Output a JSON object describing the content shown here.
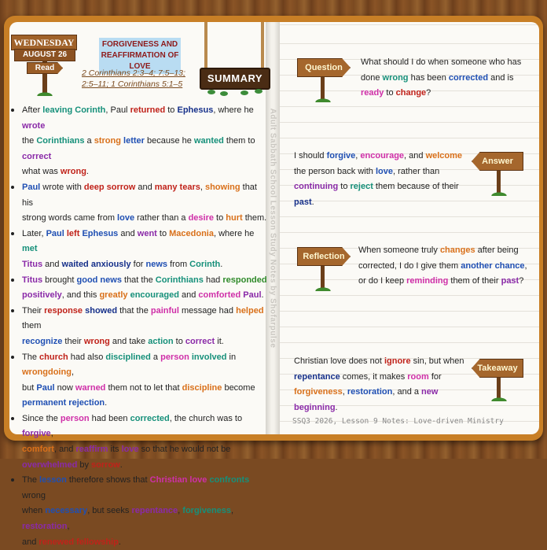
{
  "colors": {
    "red": "#c0221a",
    "blue": "#1f4fb3",
    "teal": "#16907a",
    "green": "#2f8a2a",
    "purple": "#8a2aa8",
    "orange": "#d9701a",
    "magenta": "#cf2fa8",
    "brown": "#9a6a10",
    "navy": "#16308a",
    "black": "#222222"
  },
  "day_sign": {
    "day": "WEDNESDAY",
    "date": "AUGUST 26",
    "read": "Read"
  },
  "lesson_title": {
    "line1": "FORGIVENESS AND",
    "line2": "REAFFIRMATION OF LOVE"
  },
  "references": {
    "line1": "2 Corinthians 2:3–4; 7:5–13;",
    "line2": "2:5–11; 1 Corinthians 5:1–5"
  },
  "summary_label": "SUMMARY",
  "spine_text": "Adult Sabbath School Lesson Study Notes by Shofarpulse",
  "bullets": [
    [
      [
        "After ",
        0
      ],
      [
        " leaving",
        1,
        "teal"
      ],
      [
        " Corinth",
        1,
        "teal"
      ],
      [
        ", Paul ",
        0
      ],
      [
        "returned",
        1,
        "red"
      ],
      [
        " to ",
        0
      ],
      [
        "Ephesus",
        1,
        "navy"
      ],
      [
        ", where he ",
        0
      ],
      [
        "wrote",
        1,
        "purple"
      ]
    ],
    [
      [
        "the ",
        0
      ],
      [
        "Corinthians",
        1,
        "teal"
      ],
      [
        " a ",
        0
      ],
      [
        "strong",
        1,
        "orange"
      ],
      [
        " ",
        0
      ],
      [
        "letter",
        1,
        "blue"
      ],
      [
        " because he ",
        0
      ],
      [
        "wanted",
        1,
        "teal"
      ],
      [
        " them to ",
        0
      ],
      [
        "correct",
        1,
        "purple"
      ]
    ],
    [
      [
        "what was ",
        0
      ],
      [
        "wrong",
        1,
        "red"
      ],
      [
        ".",
        0
      ]
    ],
    [
      [
        "Paul",
        1,
        "blue"
      ],
      [
        " wrote with ",
        0
      ],
      [
        "deep sorrow",
        1,
        "red"
      ],
      [
        " and ",
        0
      ],
      [
        "many tears",
        1,
        "red"
      ],
      [
        ", ",
        0
      ],
      [
        "showing",
        1,
        "orange"
      ],
      [
        " that his",
        0
      ]
    ],
    [
      [
        "strong words came from ",
        0
      ],
      [
        "love",
        1,
        "blue"
      ],
      [
        " rather than a ",
        0
      ],
      [
        "desire",
        1,
        "magenta"
      ],
      [
        " to ",
        0
      ],
      [
        "hurt",
        1,
        "orange"
      ],
      [
        " them.",
        0
      ]
    ],
    [
      [
        "Later, ",
        0
      ],
      [
        "Paul",
        1,
        "blue"
      ],
      [
        " ",
        0
      ],
      [
        "left",
        1,
        "red"
      ],
      [
        " ",
        0
      ],
      [
        "Ephesus",
        1,
        "blue"
      ],
      [
        " and ",
        0
      ],
      [
        "went",
        1,
        "purple"
      ],
      [
        " to ",
        0
      ],
      [
        "Macedonia",
        1,
        "orange"
      ],
      [
        ", where he ",
        0
      ],
      [
        "met",
        1,
        "teal"
      ]
    ],
    [
      [
        "Titus",
        1,
        "purple"
      ],
      [
        " and ",
        0
      ],
      [
        "waited anxiously",
        1,
        "navy"
      ],
      [
        " for ",
        0
      ],
      [
        "news",
        1,
        "blue"
      ],
      [
        " from ",
        0
      ],
      [
        "Corinth",
        1,
        "teal"
      ],
      [
        ".",
        0
      ]
    ],
    [
      [
        "Titus",
        1,
        "purple"
      ],
      [
        " brought ",
        0
      ],
      [
        "good news",
        1,
        "blue"
      ],
      [
        " that the ",
        0
      ],
      [
        "Corinthians",
        1,
        "teal"
      ],
      [
        " had ",
        0
      ],
      [
        "responded",
        1,
        "green"
      ]
    ],
    [
      [
        "positively",
        1,
        "purple"
      ],
      [
        ", and this ",
        0
      ],
      [
        "greatly",
        1,
        "orange"
      ],
      [
        " ",
        0
      ],
      [
        "encouraged",
        1,
        "teal"
      ],
      [
        " and ",
        0
      ],
      [
        "comforted",
        1,
        "magenta"
      ],
      [
        " ",
        0
      ],
      [
        "Paul",
        1,
        "purple"
      ],
      [
        ".",
        0
      ]
    ],
    [
      [
        "Their ",
        0
      ],
      [
        "response",
        1,
        "red"
      ],
      [
        " ",
        0
      ],
      [
        "showed",
        1,
        "navy"
      ],
      [
        " that the ",
        0
      ],
      [
        "painful",
        1,
        "magenta"
      ],
      [
        " message had ",
        0
      ],
      [
        "helped",
        1,
        "orange"
      ],
      [
        " them",
        0
      ]
    ],
    [
      [
        "recognize",
        1,
        "blue"
      ],
      [
        " their ",
        0
      ],
      [
        "wrong",
        1,
        "red"
      ],
      [
        " and take ",
        0
      ],
      [
        "action",
        1,
        "teal"
      ],
      [
        " to ",
        0
      ],
      [
        "correct",
        1,
        "purple"
      ],
      [
        " it.",
        0
      ]
    ],
    [
      [
        "The ",
        0
      ],
      [
        "church",
        1,
        "red"
      ],
      [
        " had also ",
        0
      ],
      [
        "disciplined",
        1,
        "teal"
      ],
      [
        " a ",
        0
      ],
      [
        "person",
        1,
        "magenta"
      ],
      [
        " ",
        0
      ],
      [
        "involved",
        1,
        "teal"
      ],
      [
        " in ",
        0
      ],
      [
        "wrongdoing",
        1,
        "orange"
      ],
      [
        ",",
        0
      ]
    ],
    [
      [
        "but ",
        0
      ],
      [
        "Paul",
        1,
        "blue"
      ],
      [
        " now ",
        0
      ],
      [
        "warned",
        1,
        "magenta"
      ],
      [
        " them not to let that ",
        0
      ],
      [
        "discipline",
        1,
        "orange"
      ],
      [
        " become",
        0
      ]
    ],
    [
      [
        "permanent rejection",
        1,
        "blue"
      ],
      [
        ".",
        0
      ]
    ],
    [
      [
        "Since the ",
        0
      ],
      [
        "person",
        1,
        "magenta"
      ],
      [
        " had been ",
        0
      ],
      [
        "corrected",
        1,
        "teal"
      ],
      [
        ", the church was to ",
        0
      ],
      [
        "forgive",
        1,
        "purple"
      ],
      [
        ",",
        0
      ]
    ],
    [
      [
        "comfort",
        1,
        "orange"
      ],
      [
        ", and ",
        0
      ],
      [
        "reaffirm",
        1,
        "purple"
      ],
      [
        " its ",
        0
      ],
      [
        "love",
        1,
        "purple"
      ],
      [
        " so that he would not be",
        0
      ]
    ],
    [
      [
        "overwhelmed",
        1,
        "purple"
      ],
      [
        " by ",
        0
      ],
      [
        "sorrow",
        1,
        "red"
      ],
      [
        ".",
        0
      ]
    ],
    [
      [
        "The ",
        0
      ],
      [
        "lesson",
        1,
        "blue"
      ],
      [
        " therefore shows that ",
        0
      ],
      [
        "Christian love",
        1,
        "magenta"
      ],
      [
        " ",
        0
      ],
      [
        "confronts",
        1,
        "teal"
      ],
      [
        " wrong",
        0
      ]
    ],
    [
      [
        "when ",
        0
      ],
      [
        "necessary",
        1,
        "blue"
      ],
      [
        ", but seeks ",
        0
      ],
      [
        "repentance",
        1,
        "purple"
      ],
      [
        ", ",
        0
      ],
      [
        "forgiveness",
        1,
        "teal"
      ],
      [
        ", ",
        0
      ],
      [
        "restoration",
        1,
        "purple"
      ],
      [
        ",",
        0
      ]
    ],
    [
      [
        "and ",
        0
      ],
      [
        "renewed fellowship",
        1,
        "red"
      ],
      [
        ".",
        0
      ]
    ]
  ],
  "bullet_starts": [
    0,
    3,
    5,
    7,
    9,
    11,
    14,
    17
  ],
  "question": {
    "label": "Question",
    "lines": [
      [
        [
          "What should I do when someone who has",
          0
        ]
      ],
      [
        [
          "done ",
          0
        ],
        [
          "wrong",
          1,
          "teal"
        ],
        [
          " has been ",
          0
        ],
        [
          "corrected",
          1,
          "blue"
        ],
        [
          " and is",
          0
        ]
      ],
      [
        [
          "ready",
          1,
          "magenta"
        ],
        [
          " to ",
          0
        ],
        [
          "change",
          1,
          "red"
        ],
        [
          "?",
          0
        ]
      ]
    ]
  },
  "answer": {
    "label": "Answer",
    "lines": [
      [
        [
          "I should ",
          0
        ],
        [
          "forgive",
          1,
          "blue"
        ],
        [
          ", ",
          0
        ],
        [
          "encourage",
          1,
          "magenta"
        ],
        [
          ", and ",
          0
        ],
        [
          "welcome",
          1,
          "orange"
        ]
      ],
      [
        [
          "the person back with ",
          0
        ],
        [
          "love",
          1,
          "blue"
        ],
        [
          ", rather than",
          0
        ]
      ],
      [
        [
          "continuing",
          1,
          "purple"
        ],
        [
          " to ",
          0
        ],
        [
          "reject",
          1,
          "teal"
        ],
        [
          " them because of their",
          0
        ]
      ],
      [
        [
          "past",
          1,
          "navy"
        ],
        [
          ".",
          0
        ]
      ]
    ]
  },
  "reflection": {
    "label": "Reflection",
    "lines": [
      [
        [
          "When someone truly ",
          0
        ],
        [
          "changes",
          1,
          "orange"
        ],
        [
          " after being",
          0
        ]
      ],
      [
        [
          "corrected, I do I give them ",
          0
        ],
        [
          "another chance",
          1,
          "blue"
        ],
        [
          ",",
          0
        ]
      ],
      [
        [
          "or do I keep ",
          0
        ],
        [
          "reminding",
          1,
          "magenta"
        ],
        [
          " them of their ",
          0
        ],
        [
          "past",
          1,
          "purple"
        ],
        [
          "?",
          0
        ]
      ]
    ]
  },
  "takeaway": {
    "label": "Takeaway",
    "lines": [
      [
        [
          "Christian love does not ",
          0
        ],
        [
          "ignore",
          1,
          "red"
        ],
        [
          " sin, but when",
          0
        ]
      ],
      [
        [
          "repentance",
          1,
          "navy"
        ],
        [
          " comes, it makes ",
          0
        ],
        [
          "room",
          1,
          "magenta"
        ],
        [
          " for",
          0
        ]
      ],
      [
        [
          "forgiveness",
          1,
          "orange"
        ],
        [
          ", ",
          0
        ],
        [
          "restoration",
          1,
          "blue"
        ],
        [
          ", and a ",
          0
        ],
        [
          "new",
          1,
          "purple"
        ]
      ],
      [
        [
          "beginning",
          1,
          "purple"
        ],
        [
          ".",
          0
        ]
      ]
    ]
  },
  "footer": "SSQ3 2026, Lesson 9 Notes: Love-driven Ministry"
}
